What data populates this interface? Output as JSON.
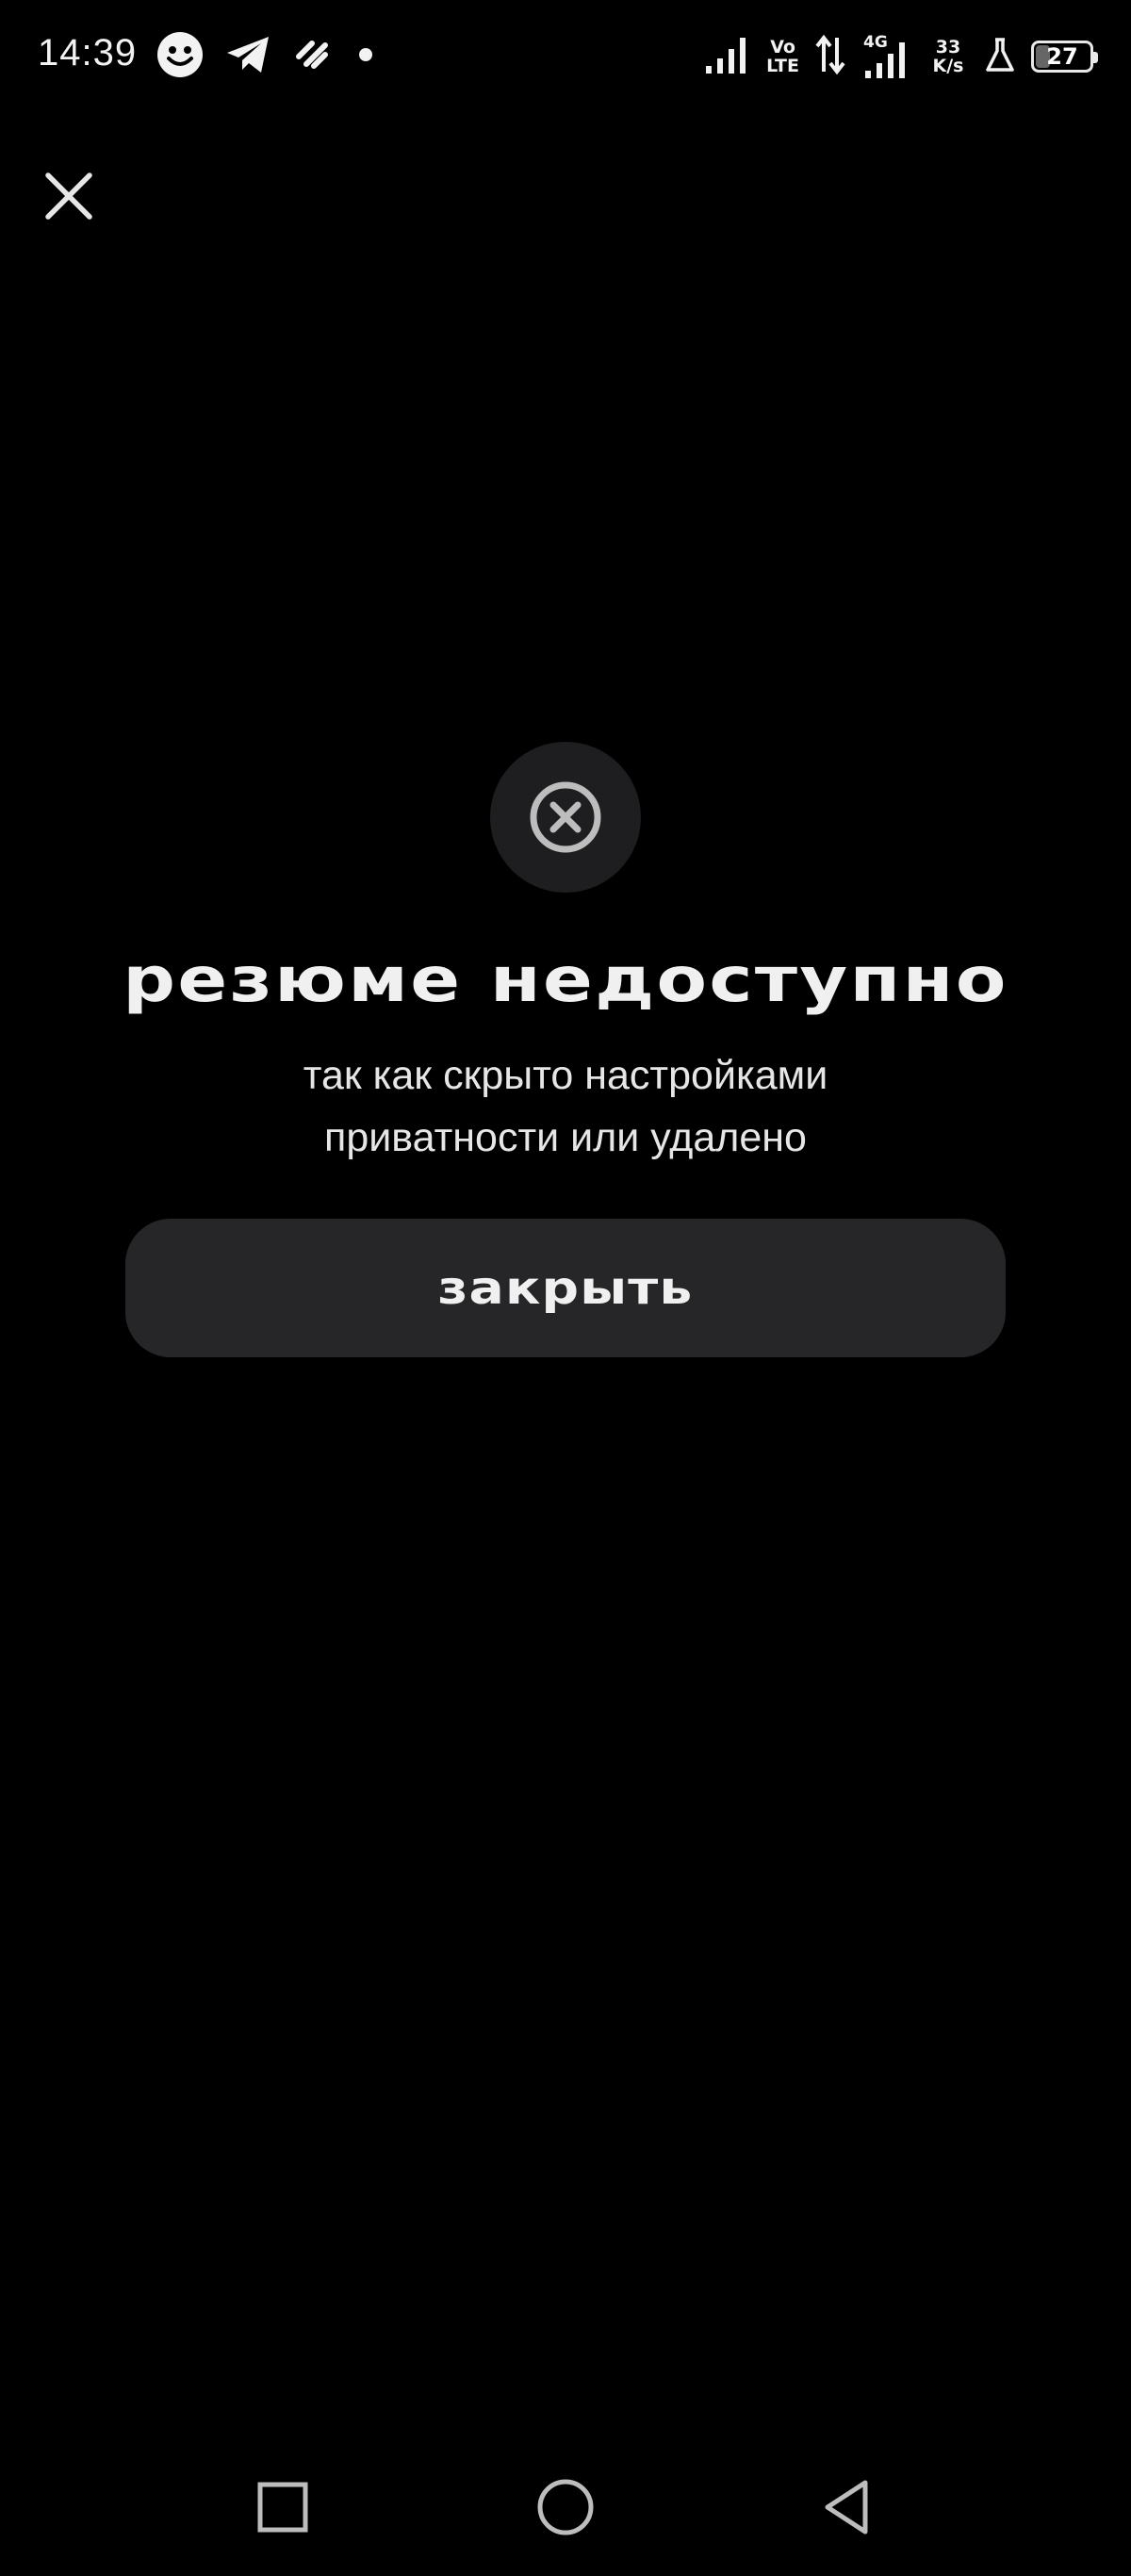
{
  "status_bar": {
    "time": "14:39",
    "network_speed_value": "33",
    "network_speed_unit": "K/s",
    "volte_top": "Vo",
    "volte_bottom": "LTE",
    "network_type": "4G",
    "battery_level": "27"
  },
  "dialog": {
    "title": "резюме недоступно",
    "subtitle_line1": "так как скрыто настройками",
    "subtitle_line2": "приватности или удалено",
    "close_button_label": "закрыть"
  },
  "colors": {
    "background": "#000000",
    "badge_background": "#1e1e20",
    "button_background": "#262628",
    "text_primary": "#f0f0f0",
    "icon_gray": "#bdbdbd"
  },
  "icons": {
    "close": "close-icon",
    "error": "error-circle-x-icon",
    "nav_recent": "square-icon",
    "nav_home": "circle-icon",
    "nav_back": "triangle-back-icon"
  }
}
